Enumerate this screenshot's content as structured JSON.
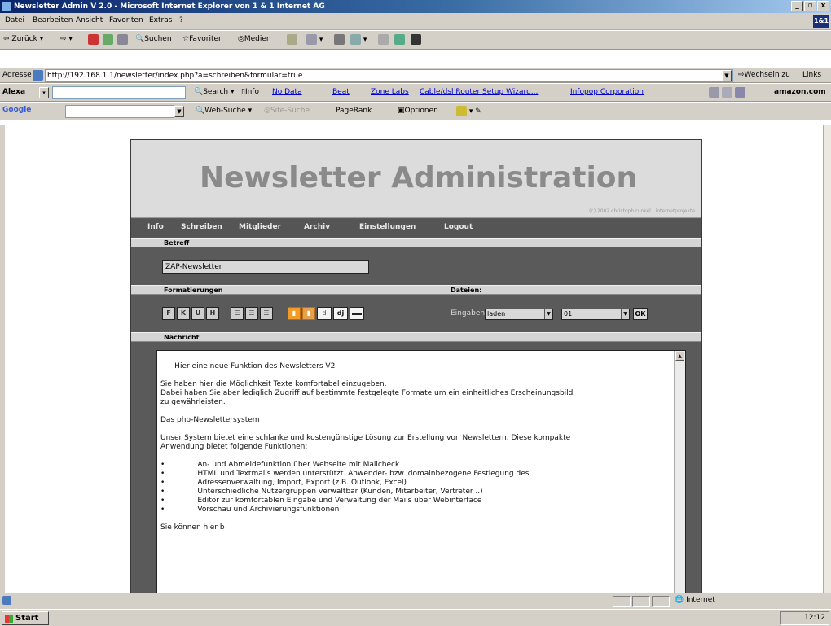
{
  "window": {
    "title": "Newsletter Admin V 2.0 - Microsoft Internet Explorer von 1 & 1 Internet AG",
    "controls": [
      "_",
      "▫",
      "x"
    ]
  },
  "menu": [
    "Datei",
    "Bearbeiten",
    "Ansicht",
    "Favoriten",
    "Extras",
    "?"
  ],
  "toolbar": {
    "back": "Zurück",
    "search": "Suchen",
    "favorites": "Favoriten",
    "media": "Medien"
  },
  "address": {
    "label": "Adresse",
    "url": "http://192.168.1.1/newsletter/index.php?a=schreiben&formular=true",
    "go": "Wechseln zu",
    "links": "Links"
  },
  "alexa": {
    "label": "Alexa",
    "search": "Search",
    "info": "Info",
    "no_data": "No Data",
    "links": [
      "Beat",
      "Zone Labs",
      "Cable/dsl Router Setup Wizard...",
      "Infopop Corporation"
    ],
    "amazon": "amazon.com"
  },
  "google": {
    "label": "Google",
    "web_search": "Web-Suche",
    "site_search": "Site-Suche",
    "pagerank": "PageRank",
    "options": "Optionen"
  },
  "app": {
    "title": "Newsletter Administration",
    "copyright": "(c) 2002 christoph runkel | internetprojekte",
    "nav": [
      "Info",
      "Schreiben",
      "Mitglieder",
      "Archiv",
      "Einstellungen",
      "Logout"
    ],
    "subject_label": "Betreff",
    "subject_value": "ZAP-Newsletter",
    "formatting_label": "Formatierungen",
    "files_label": "Dateien:",
    "format_buttons": [
      "F",
      "K",
      "U",
      "H"
    ],
    "insert_label": "Eingaben",
    "insert_action": "laden",
    "insert_number": "01",
    "ok": "OK",
    "message_label": "Nachricht",
    "message_text": "Hier eine neue Funktion des Newsletters V2\n\nSie haben hier die Möglichkeit Texte komfortabel einzugeben.\nDabei haben Sie aber lediglich Zugriff auf bestimmte festgelegte Formate um ein einheitliches Erscheinungsbild\nzu gewährleisten.\n\nDas php-Newslettersystem\n\nUnser System bietet eine schlanke und kostengünstige Lösung zur Erstellung von Newslettern. Diese kompakte\nAnwendung bietet folgende Funktionen:\n\n•              An- und Abmeldefunktion über Webseite mit Mailcheck\n•              HTML und Textmails werden unterstützt. Anwender- bzw. domainbezogene Festlegung des\n•              Adressenverwaltung, Import, Export (z.B. Outlook, Excel)\n•              Unterschiedliche Nutzergruppen verwaltbar (Kunden, Mitarbeiter, Vertreter ..)\n•              Editor zur komfortablen Eingabe und Verwaltung der Mails über Webinterface\n•              Vorschau und Archivierungsfunktionen\n\nSie können hier b"
  },
  "status": {
    "zone": "Internet"
  },
  "taskbar": {
    "start": "Start",
    "clock": "12:12"
  }
}
